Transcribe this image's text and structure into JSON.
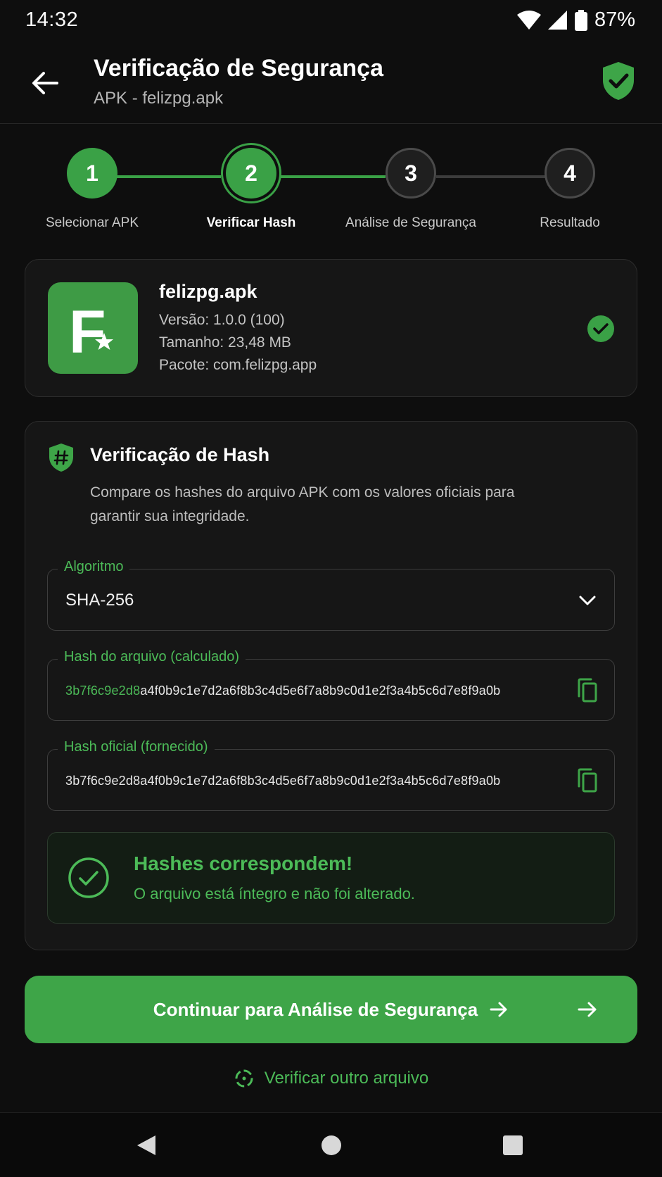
{
  "status_bar": {
    "time": "14:32",
    "battery": "87%",
    "icons": [
      "wifi-icon",
      "signal-icon",
      "battery-icon"
    ]
  },
  "app_bar": {
    "title": "Verificação de Segurança",
    "subtitle": "APK - felizpg.apk",
    "back_icon": "arrow-left-icon",
    "status_icon": "shield-check-icon"
  },
  "stepper": {
    "steps": [
      {
        "number": "1",
        "label": "Selecionar APK",
        "state": "done"
      },
      {
        "number": "2",
        "label": "Verificar Hash",
        "state": "active"
      },
      {
        "number": "3",
        "label": "Análise de Segurança",
        "state": "todo"
      },
      {
        "number": "4",
        "label": "Resultado",
        "state": "todo"
      }
    ]
  },
  "apk": {
    "icon_letter": "F",
    "name": "felizpg.apk",
    "version": "Versão: 1.0.0 (100)",
    "size": "Tamanho: 23,48 MB",
    "package": "Pacote: com.felizpg.app",
    "verified_icon": "check-circle-icon"
  },
  "hash_section": {
    "title": "Verificação de Hash",
    "description": "Compare os hashes do arquivo APK com os valores oficiais para garantir sua integridade.",
    "algorithm": {
      "label": "Algoritmo",
      "value": "SHA-256"
    },
    "computed": {
      "label": "Hash do arquivo (calculado)",
      "highlight": "3b7f6c9e2d8",
      "rest": "a4f0b9c1e7d2a6f8b3c4d5e6f7a8b9c0d1e2f3a4b5c6d7e8f9a0b"
    },
    "official": {
      "label": "Hash oficial (fornecido)",
      "value": "3b7f6c9e2d8a4f0b9c1e7d2a6f8b3c4d5e6f7a8b9c0d1e2f3a4b5c6d7e8f9a0b"
    },
    "result": {
      "title": "Hashes correspondem!",
      "subtitle": "O arquivo está íntegro e não foi alterado."
    }
  },
  "actions": {
    "primary": "Continuar para Análise de Segurança",
    "secondary": "Verificar outro arquivo"
  },
  "colors": {
    "accent": "#3ea548",
    "accent_text": "#4cbb58",
    "background": "#0e0e0e",
    "card": "#161616"
  }
}
